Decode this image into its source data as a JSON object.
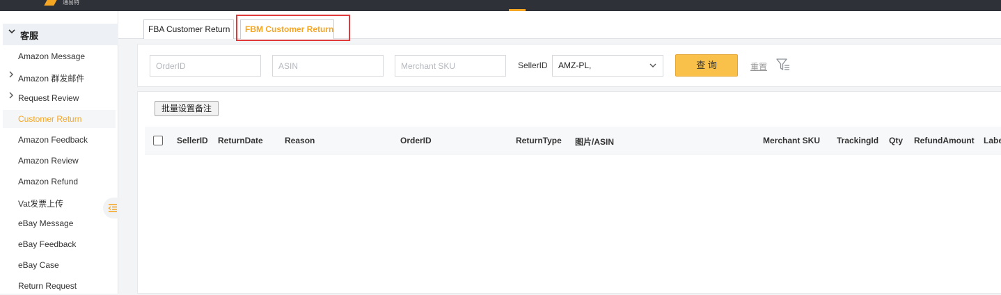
{
  "header": {
    "logo_text": "通易特",
    "accent_color": "#f5a623"
  },
  "sidebar": {
    "group_label": "客服",
    "items": [
      {
        "label": "Amazon Message",
        "has_arrow": false,
        "active": false
      },
      {
        "label": "Amazon 群发邮件",
        "has_arrow": true,
        "active": false
      },
      {
        "label": "Request Review",
        "has_arrow": true,
        "active": false
      },
      {
        "label": "Customer Return",
        "has_arrow": false,
        "active": true
      },
      {
        "label": "Amazon Feedback",
        "has_arrow": false,
        "active": false
      },
      {
        "label": "Amazon Review",
        "has_arrow": false,
        "active": false
      },
      {
        "label": "Amazon Refund",
        "has_arrow": false,
        "active": false
      },
      {
        "label": "Vat发票上传",
        "has_arrow": false,
        "active": false
      },
      {
        "label": "eBay Message",
        "has_arrow": false,
        "active": false
      },
      {
        "label": "eBay Feedback",
        "has_arrow": false,
        "active": false
      },
      {
        "label": "eBay Case",
        "has_arrow": false,
        "active": false
      },
      {
        "label": "Return Request",
        "has_arrow": false,
        "active": false
      }
    ]
  },
  "tabs": [
    {
      "label": "FBA Customer Return",
      "active": false
    },
    {
      "label": "FBM Customer Return",
      "active": true
    }
  ],
  "search": {
    "orderid_placeholder": "OrderID",
    "asin_placeholder": "ASIN",
    "sku_placeholder": "Merchant SKU",
    "seller_label": "SellerID",
    "seller_value": "AMZ-PL,",
    "query_label": "查 询",
    "reset_label": "重置"
  },
  "content": {
    "bulk_button": "批量设置备注",
    "columns": [
      "SellerID",
      "ReturnDate",
      "Reason",
      "OrderID",
      "ReturnType",
      "图片/ASIN",
      "Merchant SKU",
      "TrackingId",
      "Qty",
      "RefundAmount",
      "Label"
    ]
  }
}
